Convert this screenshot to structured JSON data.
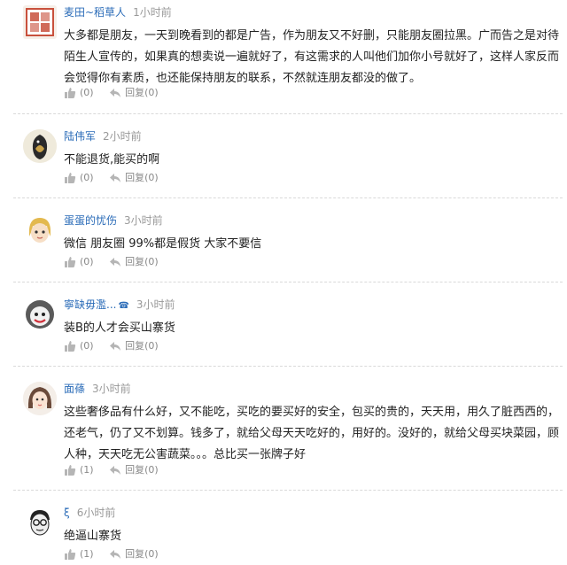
{
  "comments": [
    {
      "user": "麦田~稻草人",
      "time": "1小时前",
      "text": "大多都是朋友，一天到晚看到的都是广告，作为朋友又不好删，只能朋友圈拉黑。广而告之是对待陌生人宣传的，如果真的想卖说一遍就好了，有这需求的人叫他们加你小号就好了，这样人家反而会觉得你有素质，也还能保持朋友的联系，不然就连朋友都没的做了。",
      "likes": "(0)",
      "reply_label": "回复",
      "replies": "(0)",
      "avatar_icon": "stamp-avatar-icon"
    },
    {
      "user": "陆伟军",
      "time": "2小时前",
      "text": "不能退货,能买的啊",
      "likes": "(0)",
      "reply_label": "回复",
      "replies": "(0)",
      "avatar_icon": "bird-avatar-icon"
    },
    {
      "user": "蛋蛋的忧伤",
      "time": "3小时前",
      "text": "微信  朋友圈  99%都是假货  大家不要信",
      "likes": "(0)",
      "reply_label": "回复",
      "replies": "(0)",
      "avatar_icon": "doll-avatar-icon"
    },
    {
      "user": "寧缺毋濫...",
      "badge": "☎",
      "time": "3小时前",
      "text": "装B的人才会买山寨货",
      "likes": "(0)",
      "reply_label": "回复",
      "replies": "(0)",
      "avatar_icon": "cartoon-face-avatar-icon"
    },
    {
      "user": "面蓧",
      "time": "3小时前",
      "text": "这些奢侈品有什么好，又不能吃，买吃的要买好的安全，包买的贵的，天天用，用久了脏西西的，还老气，仍了又不划算。钱多了，就给父母天天吃好的，用好的。没好的，就给父母买块菜园，顾人种，天天吃无公害蔬菜。。。总比买一张牌子好",
      "likes": "(1)",
      "reply_label": "回复",
      "replies": "(0)",
      "avatar_icon": "girl-avatar-icon"
    },
    {
      "user": "ξ",
      "time": "6小时前",
      "text": "绝逼山寨货",
      "likes": "(1)",
      "reply_label": "回复",
      "replies": "(0)",
      "avatar_icon": "glasses-face-avatar-icon"
    }
  ],
  "colors": {
    "username": "#2b6cb8",
    "meta": "#999999",
    "separator": "#d9d9d9"
  }
}
